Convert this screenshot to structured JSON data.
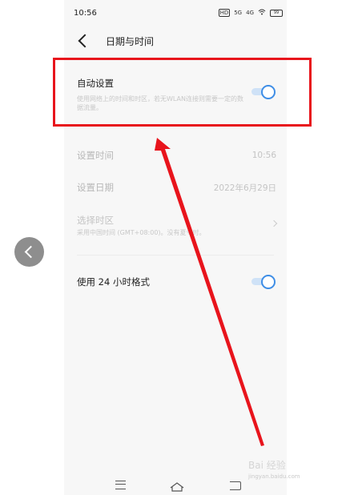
{
  "status_bar": {
    "time": "10:56",
    "icons": [
      "hd-icon",
      "5g-signal-icon",
      "4g-signal-icon",
      "wifi-icon",
      "battery-icon"
    ],
    "hd": "HD",
    "net_a": "5G",
    "net_b": "4G",
    "battery": "99"
  },
  "header": {
    "title": "日期与时间"
  },
  "auto_setting": {
    "label": "自动设置",
    "description": "使用网络上的时间和时区，若无WLAN连接则需要一定的数据流量。",
    "enabled": true
  },
  "set_time": {
    "label": "设置时间",
    "value": "10:56"
  },
  "set_date": {
    "label": "设置日期",
    "value": "2022年6月29日"
  },
  "time_zone": {
    "label": "选择时区",
    "description": "采用中国时间 (GMT+08:00)。没有夏令时。"
  },
  "format_24h": {
    "label": "使用 24 小时格式",
    "enabled": true
  },
  "watermark": {
    "text": "Bai 经验",
    "url": "jingyan.baidu.com"
  },
  "colors": {
    "highlight_box": "#e8141c",
    "toggle_accent": "#3f8ee6",
    "arrow": "#e8141c"
  }
}
